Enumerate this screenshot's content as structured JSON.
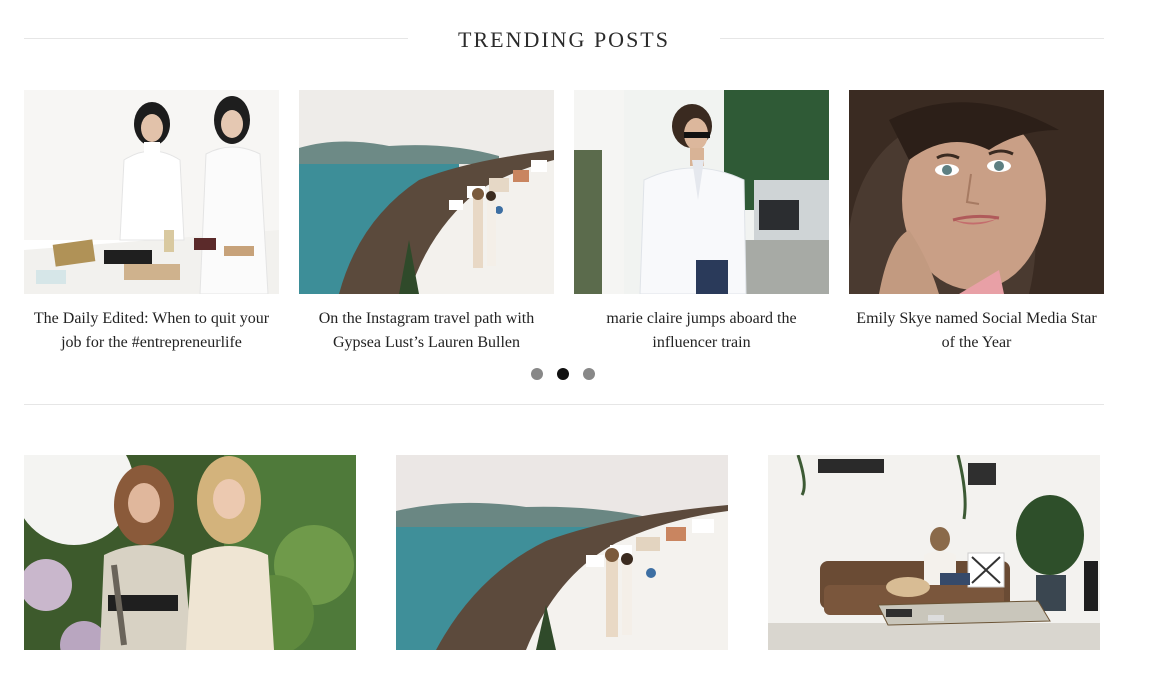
{
  "section": {
    "title": "TRENDING POSTS"
  },
  "trending": [
    {
      "title": "The Daily Edited: When to quit your job for the #entrepreneurlife",
      "image": "two-women-at-desk-photo"
    },
    {
      "title": "On the Instagram travel path with Gypsea Lust’s Lauren Bullen",
      "image": "santorini-couple-photo"
    },
    {
      "title": "marie claire jumps aboard the influencer train",
      "image": "woman-white-shirt-photo"
    },
    {
      "title": "Emily Skye named Social Media Star of the Year",
      "image": "woman-portrait-photo"
    }
  ],
  "carousel": {
    "pages": 3,
    "active_page": 2
  },
  "posts": [
    {
      "image": "two-women-balloons-photo"
    },
    {
      "image": "santorini-couple-photo"
    },
    {
      "image": "woman-on-sofa-with-dog-photo"
    }
  ],
  "colors": {
    "dot_inactive": "#888888",
    "dot_active": "#111111",
    "rule": "#e6e6e6"
  }
}
